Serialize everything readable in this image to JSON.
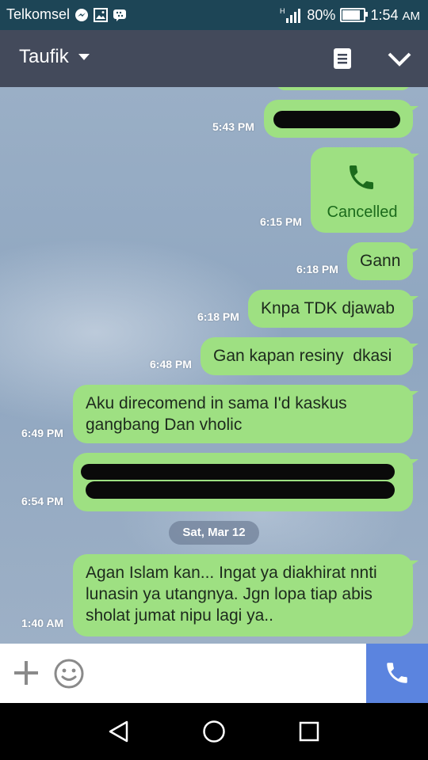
{
  "status_bar": {
    "carrier": "Telkomsel",
    "network": "H",
    "battery": "80%",
    "time": "1:54",
    "ampm": "AM",
    "icons": [
      "messenger-icon",
      "gallery-icon",
      "bbm-icon",
      "signal-icon",
      "battery-icon"
    ]
  },
  "header": {
    "title": "Taufik",
    "icons": [
      "dropdown-caret-icon",
      "notes-icon",
      "chevron-down-icon"
    ]
  },
  "messages": [
    {
      "time": "5:43 PM",
      "text": "",
      "redacted": true
    },
    {
      "time": "6:15 PM",
      "type": "call",
      "text": "Cancelled"
    },
    {
      "time": "6:18 PM",
      "text": "Gann"
    },
    {
      "time": "6:18 PM",
      "text": "Knpa TDK djawab"
    },
    {
      "time": "6:48 PM",
      "text": "Gan kapan resiny  dkasi"
    },
    {
      "time": "6:49 PM",
      "text": "Aku direcomend in sama I'd kaskus gangbang Dan vholic"
    },
    {
      "time": "6:54 PM",
      "text": "",
      "redacted": true
    },
    {
      "time": "1:40 AM",
      "text": "Agan Islam kan... Ingat ya diakhirat nnti lunasin ya utangnya. Jgn lopa tiap abis sholat jumat nipu lagi ya.."
    }
  ],
  "date_separator": "Sat, Mar 12",
  "input_bar": {
    "icons": [
      "plus-icon",
      "emoji-icon",
      "phone-icon"
    ]
  },
  "colors": {
    "status_bar": "#1d4556",
    "header": "#434a5b",
    "bubble": "#9ee082",
    "call_button": "#5b84df"
  }
}
